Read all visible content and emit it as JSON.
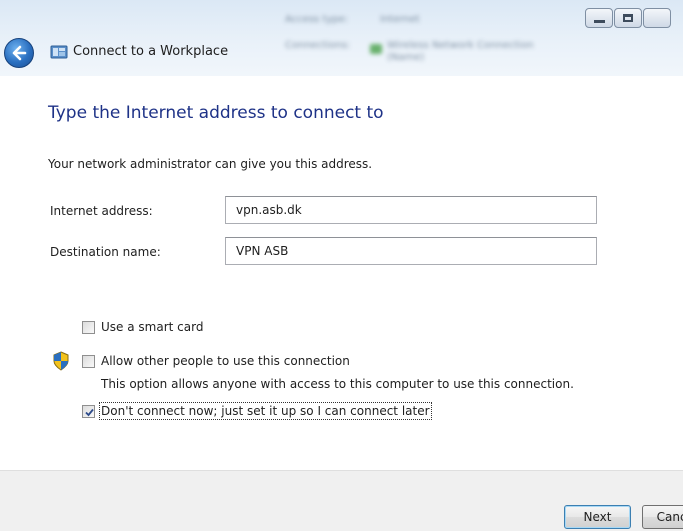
{
  "window": {
    "title": "Connect to a Workplace",
    "blurred_info": {
      "access_type_label": "Access type:",
      "access_type_value": "Internet",
      "connections_label": "Connections:",
      "connections_value": "Wireless Network Connection",
      "connections_value_2": "(Name)"
    }
  },
  "content": {
    "heading": "Type the Internet address to connect to",
    "subtext": "Your network administrator can give you this address.",
    "fields": [
      {
        "label": "Internet address:",
        "value": "vpn.asb.dk"
      },
      {
        "label": "Destination name:",
        "value": "VPN ASB"
      }
    ],
    "options": [
      {
        "label": "Use a smart card",
        "checked": false
      },
      {
        "label": "Allow other people to use this connection",
        "checked": false,
        "description": "This option allows anyone with access to this computer to use this connection."
      },
      {
        "label": "Don't connect now; just set it up so I can connect later",
        "checked": true
      }
    ]
  },
  "footer": {
    "next_label": "Next",
    "cancel_label": "Cancel"
  },
  "colors": {
    "heading": "#1e3287",
    "titlebar": "#dbe8f5",
    "footer": "#f0f0f0"
  }
}
